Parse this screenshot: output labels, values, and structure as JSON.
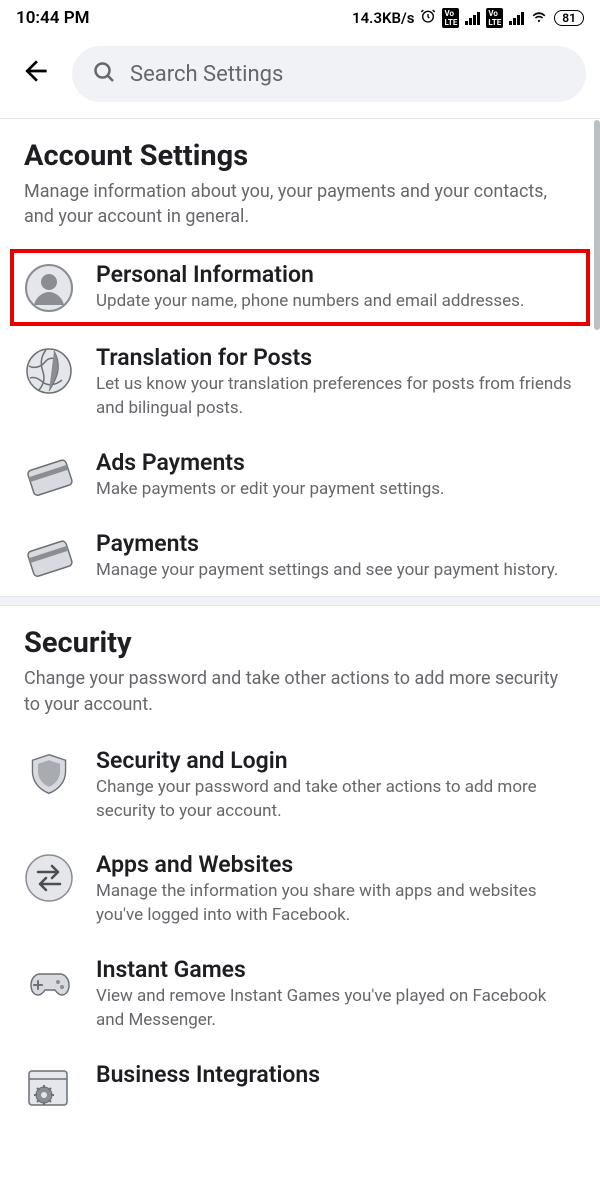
{
  "statusBar": {
    "time": "10:44 PM",
    "dataRate": "14.3KB/s",
    "battery": "81"
  },
  "search": {
    "placeholder": "Search Settings"
  },
  "sections": {
    "account": {
      "title": "Account Settings",
      "desc": "Manage information about you, your payments and your contacts, and your account in general."
    },
    "security": {
      "title": "Security",
      "desc": "Change your password and take other actions to add more security to your account."
    }
  },
  "items": {
    "personal": {
      "title": "Personal Information",
      "desc": "Update your name, phone numbers and email addresses."
    },
    "translation": {
      "title": "Translation for Posts",
      "desc": "Let us know your translation preferences for posts from friends and bilingual posts."
    },
    "adsPayments": {
      "title": "Ads Payments",
      "desc": "Make payments or edit your payment settings."
    },
    "payments": {
      "title": "Payments",
      "desc": "Manage your payment settings and see your payment history."
    },
    "securityLogin": {
      "title": "Security and Login",
      "desc": "Change your password and take other actions to add more security to your account."
    },
    "apps": {
      "title": "Apps and Websites",
      "desc": "Manage the information you share with apps and websites you've logged into with Facebook."
    },
    "games": {
      "title": "Instant Games",
      "desc": "View and remove Instant Games you've played on Facebook and Messenger."
    },
    "business": {
      "title": "Business Integrations"
    }
  }
}
